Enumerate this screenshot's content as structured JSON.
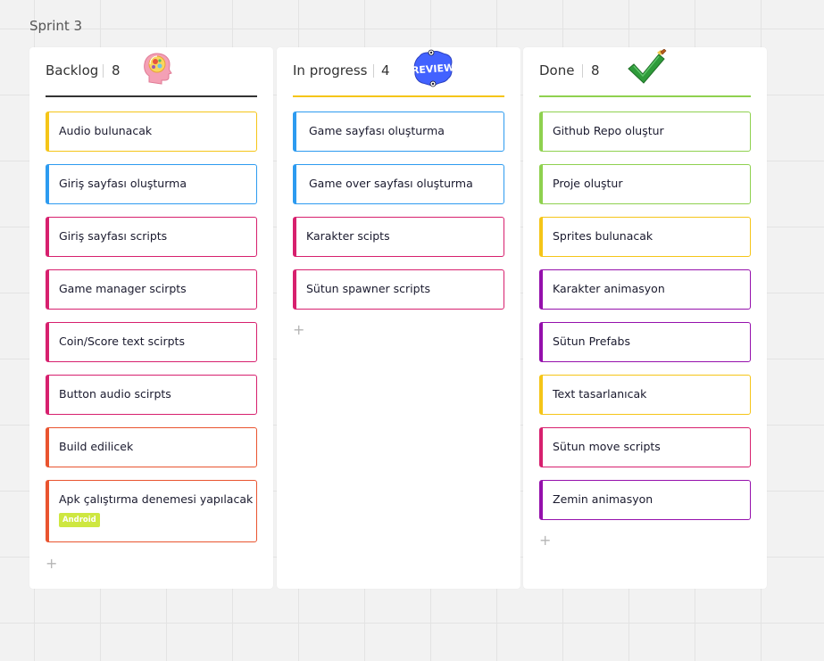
{
  "frame": {
    "title": "Sprint 3"
  },
  "columns": [
    {
      "title": "Backlog",
      "count": "8",
      "underline": "#333333",
      "icon": "brain-head-icon",
      "cards": [
        {
          "text": "Audio bulunacak",
          "color": "#f5c518"
        },
        {
          "text": "Giriş sayfası oluşturma",
          "color": "#2d9bf0"
        },
        {
          "text": "Giriş sayfası scripts",
          "color": "#d7206e"
        },
        {
          "text": "Game manager scirpts",
          "color": "#d7206e"
        },
        {
          "text": "Coin/Score text scirpts",
          "color": "#d7206e"
        },
        {
          "text": "Button audio scirpts",
          "color": "#d7206e"
        },
        {
          "text": "Build edilicek",
          "color": "#e9542f"
        },
        {
          "text": "Apk çalıştırma denemesi yapılacak",
          "color": "#e9542f",
          "tag": "Android"
        }
      ],
      "add_label": "+"
    },
    {
      "title": "In progress",
      "count": "4",
      "underline": "#f5c518",
      "icon": "review-sticker-icon",
      "icon_text": "REVIEW",
      "cards": [
        {
          "text": "Game sayfası oluşturma",
          "color": "#2d9bf0"
        },
        {
          "text": "Game over sayfası oluşturma",
          "color": "#2d9bf0"
        },
        {
          "text": "Karakter scipts",
          "color": "#d7206e"
        },
        {
          "text": "Sütun spawner scripts",
          "color": "#d7206e"
        }
      ],
      "add_label": "+"
    },
    {
      "title": "Done",
      "count": "8",
      "underline": "#8fd14f",
      "icon": "checkmark-icon",
      "cards": [
        {
          "text": "Github Repo oluştur",
          "color": "#8fd14f"
        },
        {
          "text": "Proje oluştur",
          "color": "#8fd14f"
        },
        {
          "text": "Sprites bulunacak",
          "color": "#f5c518"
        },
        {
          "text": "Karakter animasyon",
          "color": "#9510ac"
        },
        {
          "text": "Sütun Prefabs",
          "color": "#9510ac"
        },
        {
          "text": "Text tasarlanıcak",
          "color": "#f5c518"
        },
        {
          "text": "Sütun move scripts",
          "color": "#d7206e"
        },
        {
          "text": "Zemin animasyon",
          "color": "#9510ac"
        }
      ],
      "add_label": "+"
    }
  ]
}
